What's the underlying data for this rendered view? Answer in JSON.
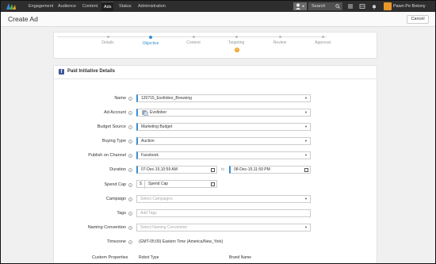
{
  "nav": {
    "items": [
      {
        "label": "Engagement"
      },
      {
        "label": "Audience"
      },
      {
        "label": "Content"
      },
      {
        "label": "Ads"
      },
      {
        "label": "Status"
      },
      {
        "label": "Administration"
      }
    ],
    "search_placeholder": "Search",
    "user_name": "Pawn Pe Botony"
  },
  "page": {
    "title": "Create Ad",
    "cancel_label": "Cancel"
  },
  "stepper": {
    "steps": [
      {
        "label": "Details"
      },
      {
        "label": "Objective"
      },
      {
        "label": "Content"
      },
      {
        "label": "Targeting"
      },
      {
        "label": "Review"
      },
      {
        "label": "Approval"
      }
    ],
    "active_index": 1,
    "warning_badge": "!"
  },
  "section": {
    "title": "Paid Initiative Details"
  },
  "form": {
    "name": {
      "label": "Name",
      "value": "120715_Evoltobor_Browsing"
    },
    "ad_account": {
      "label": "Ad Account",
      "value": "Evoltobor"
    },
    "budget_source": {
      "label": "Budget Source",
      "value": "Marketing Budget"
    },
    "buying_type": {
      "label": "Buying Type",
      "value": "Auction"
    },
    "publish_channel": {
      "label": "Publish on Channel",
      "value": "Facebook"
    },
    "duration": {
      "label": "Duration",
      "start": "07-Dec-15,10:59 AM",
      "to": "to",
      "end": "08-Dec-15,11:59 PM"
    },
    "spend_cap": {
      "label": "Spend Cap",
      "currency": "$",
      "placeholder": "Spend Cap"
    },
    "campaign": {
      "label": "Campaign",
      "placeholder": "Select Campaigns"
    },
    "tags": {
      "label": "Tags",
      "placeholder": "Add Tags"
    },
    "naming_convention": {
      "label": "Naming Convention",
      "placeholder": "Select Naming Convention"
    },
    "timezone": {
      "label": "Timezone",
      "value": "(GMT-05:00) Eastern Time (America/New_York)"
    },
    "custom_properties": {
      "label": "Custom Properties",
      "col1": "Robot Type",
      "col2": "Brand Name"
    }
  },
  "colors": {
    "nav_bg": "#2e2e2e",
    "accent": "#3a8fd1",
    "facebook": "#3b5998",
    "warning": "#f0a22e"
  }
}
